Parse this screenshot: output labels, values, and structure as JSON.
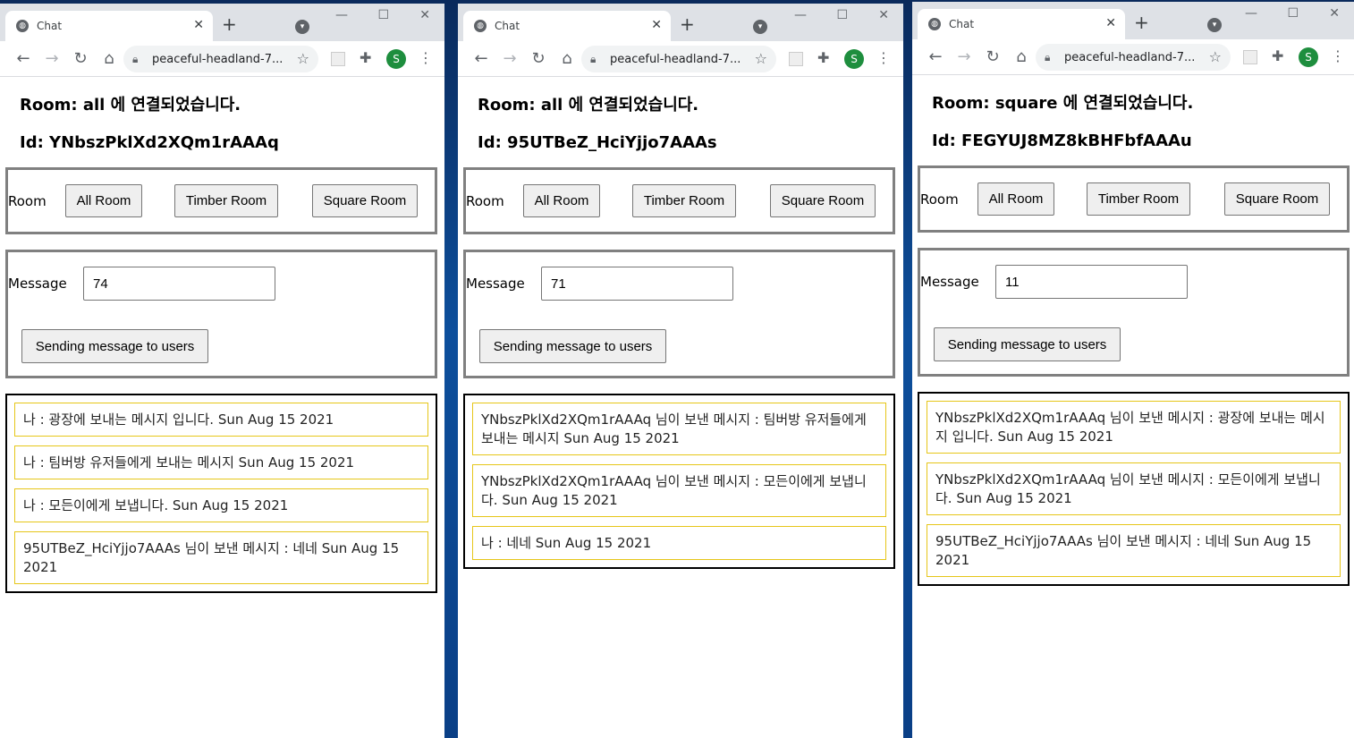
{
  "windows": [
    {
      "tab_title": "Chat",
      "url": "peaceful-headland-7...",
      "avatar_letter": "S",
      "room_heading": "Room: all 에 연결되었습니다.",
      "id_heading": "Id: YNbszPklXd2XQm1rAAAq",
      "room_label": "Room",
      "buttons": {
        "all": "All Room",
        "timber": "Timber Room",
        "square": "Square Room"
      },
      "message_label": "Message",
      "message_value": "74",
      "send_label": "Sending message to users",
      "messages": [
        "나 : 광장에 보내는 메시지 입니다. Sun Aug 15 2021",
        "나 : 팀버방 유저들에게 보내는 메시지 Sun Aug 15 2021",
        "나 : 모든이에게 보냅니다. Sun Aug 15 2021",
        "95UTBeZ_HciYjjo7AAAs 님이 보낸 메시지 : 네네 Sun Aug 15 2021"
      ]
    },
    {
      "tab_title": "Chat",
      "url": "peaceful-headland-7...",
      "avatar_letter": "S",
      "room_heading": "Room: all 에 연결되었습니다.",
      "id_heading": "Id: 95UTBeZ_HciYjjo7AAAs",
      "room_label": "Room",
      "buttons": {
        "all": "All Room",
        "timber": "Timber Room",
        "square": "Square Room"
      },
      "message_label": "Message",
      "message_value": "71",
      "send_label": "Sending message to users",
      "messages": [
        "YNbszPklXd2XQm1rAAAq 님이 보낸 메시지 : 팀버방 유저들에게 보내는 메시지 Sun Aug 15 2021",
        "YNbszPklXd2XQm1rAAAq 님이 보낸 메시지 : 모든이에게 보냅니다. Sun Aug 15 2021",
        "나 : 네네 Sun Aug 15 2021"
      ]
    },
    {
      "tab_title": "Chat",
      "url": "peaceful-headland-7...",
      "avatar_letter": "S",
      "room_heading": "Room: square 에 연결되었습니다.",
      "id_heading": "Id: FEGYUJ8MZ8kBHFbfAAAu",
      "room_label": "Room",
      "buttons": {
        "all": "All Room",
        "timber": "Timber Room",
        "square": "Square Room"
      },
      "message_label": "Message",
      "message_value": "11",
      "send_label": "Sending message to users",
      "messages": [
        "YNbszPklXd2XQm1rAAAq 님이 보낸 메시지 : 광장에 보내는 메시지 입니다. Sun Aug 15 2021",
        "YNbszPklXd2XQm1rAAAq 님이 보낸 메시지 : 모든이에게 보냅니다. Sun Aug 15 2021",
        "95UTBeZ_HciYjjo7AAAs 님이 보낸 메시지 : 네네 Sun Aug 15 2021"
      ]
    }
  ],
  "icons": {
    "favicon": "globe-icon",
    "close": "close-icon",
    "new_tab": "plus-icon",
    "tab_search": "tab-search-icon",
    "back": "arrow-left-icon",
    "forward": "arrow-right-icon",
    "reload": "reload-icon",
    "home": "home-icon",
    "lock": "lock-icon",
    "star": "star-icon",
    "extensions": "puzzle-icon",
    "menu": "kebab-icon"
  },
  "colors": {
    "message_border": "#e6c619",
    "section_border": "#808080",
    "log_border": "#000000",
    "avatar": "#1e8e3e"
  }
}
